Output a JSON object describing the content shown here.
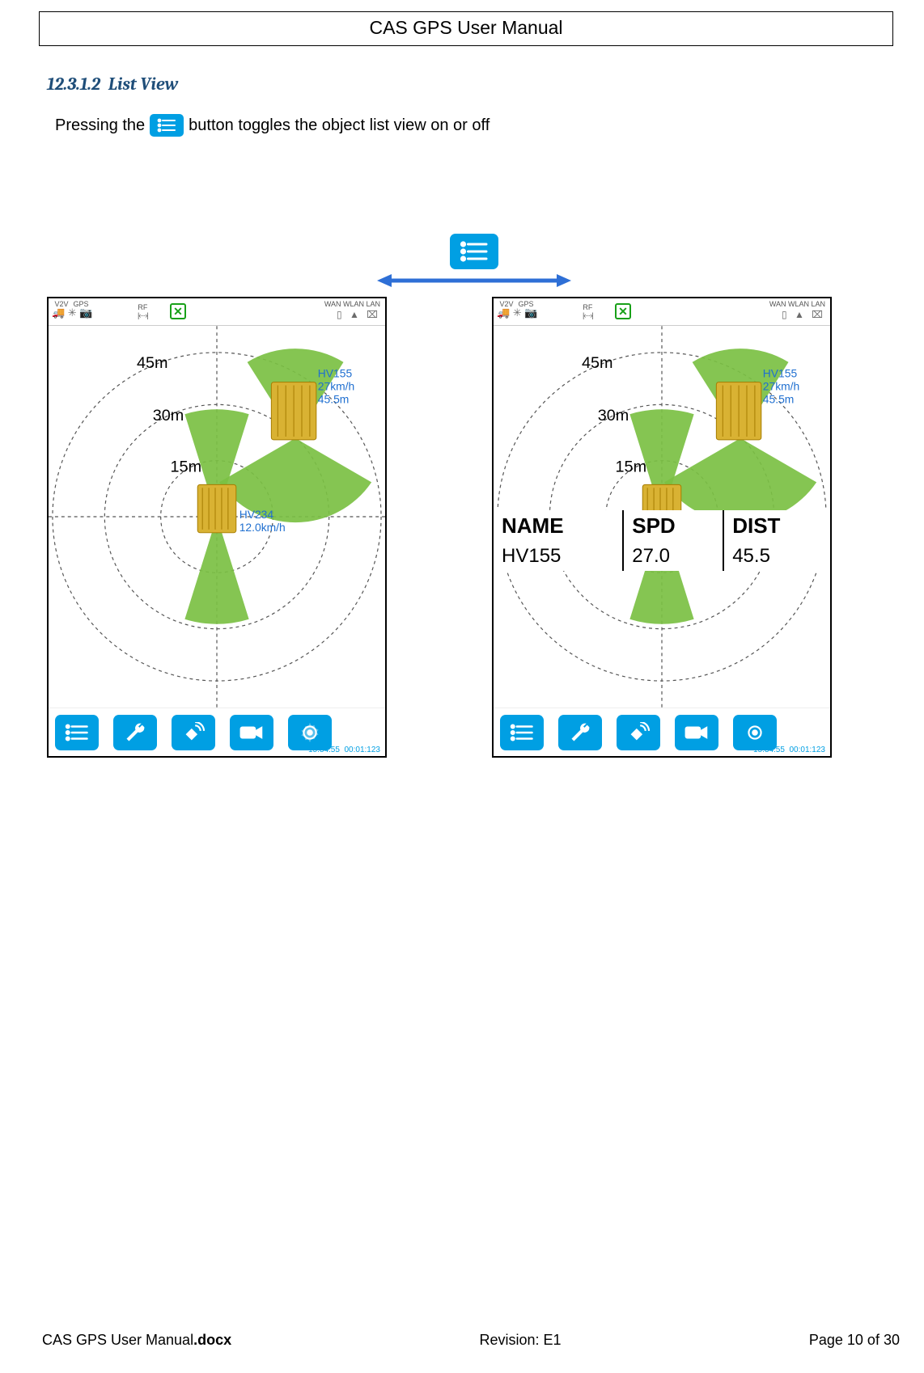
{
  "header": {
    "title": "CAS GPS User Manual"
  },
  "section": {
    "number": "12.3.1.2",
    "title": "List View"
  },
  "intro": {
    "pre": "Pressing the",
    "post": "button toggles the object list view on or off"
  },
  "radar": {
    "rings": [
      "45m",
      "30m",
      "15m"
    ],
    "vehicles": [
      {
        "name": "HV155",
        "speed": "27km/h",
        "dist": "45.5m"
      },
      {
        "name": "HV234",
        "speed": "12.0km/h"
      }
    ]
  },
  "topbar": {
    "left_labels": [
      "V2V",
      "GPS"
    ],
    "rf": "RF",
    "right_labels": "WAN WLAN LAN"
  },
  "list": {
    "headers": [
      "NAME",
      "SPD",
      "DIST"
    ],
    "rows": [
      {
        "name": "HV155",
        "spd": "27.0",
        "dist": "45.5"
      }
    ]
  },
  "timestamps": {
    "left": "15:34:55",
    "right": "00:01:123"
  },
  "footer": {
    "file_base": "CAS GPS User Manual",
    "file_ext": ".docx",
    "rev": "Revision: E1",
    "page": "Page 10 of 30"
  }
}
